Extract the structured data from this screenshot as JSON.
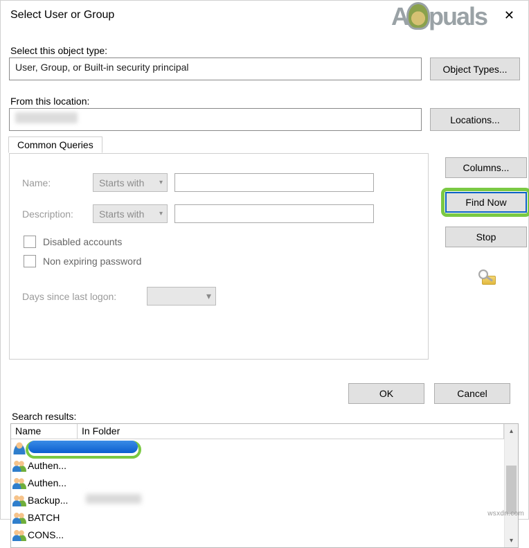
{
  "window": {
    "title": "Select User or Group",
    "close_glyph": "✕"
  },
  "watermark": {
    "text_left": "A",
    "text_right": "puals"
  },
  "labels": {
    "object_type": "Select this object type:",
    "from_location": "From this location:",
    "search_results": "Search results:"
  },
  "fields": {
    "object_type_value": "User, Group, or Built-in security principal",
    "location_value": "(redacted)"
  },
  "buttons": {
    "object_types": "Object Types...",
    "locations": "Locations...",
    "columns": "Columns...",
    "find_now": "Find Now",
    "stop": "Stop",
    "ok": "OK",
    "cancel": "Cancel"
  },
  "common_queries": {
    "tab_label": "Common Queries",
    "name_label": "Name:",
    "description_label": "Description:",
    "name_match_mode": "Starts with",
    "description_match_mode": "Starts with",
    "name_value": "",
    "description_value": "",
    "chk_disabled": "Disabled accounts",
    "chk_nonexpiring": "Non expiring password",
    "days_label": "Days since last logon:",
    "days_value": ""
  },
  "results": {
    "columns": {
      "name": "Name",
      "in_folder": "In Folder"
    },
    "rows": [
      {
        "icon": "user",
        "name": "(selected, redacted)",
        "folder": "",
        "selected": true
      },
      {
        "icon": "group",
        "name": "Authen...",
        "folder": ""
      },
      {
        "icon": "group",
        "name": "Authen...",
        "folder": ""
      },
      {
        "icon": "group",
        "name": "Backup...",
        "folder": "(redacted)"
      },
      {
        "icon": "group",
        "name": "BATCH",
        "folder": ""
      },
      {
        "icon": "group",
        "name": "CONS...",
        "folder": ""
      }
    ]
  },
  "footer": {
    "credit": "wsxdn.com"
  },
  "colors": {
    "highlight_green": "#7ac943",
    "focus_blue": "#0a62c4",
    "selection_gradient_top": "#3a8be6",
    "selection_gradient_bottom": "#0b5fcf"
  }
}
